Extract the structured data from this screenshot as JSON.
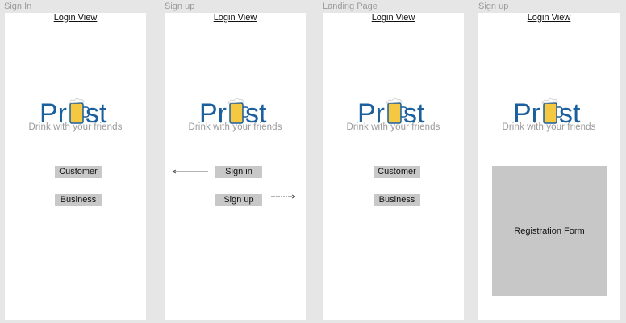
{
  "artboards": [
    {
      "title": "Sign In",
      "link": "Login View",
      "buttons": [
        "Customer",
        "Business"
      ]
    },
    {
      "title": "Sign up",
      "link": "Login View",
      "buttons": [
        "Sign in",
        "Sign up"
      ]
    },
    {
      "title": "Landing Page",
      "link": "Login View",
      "buttons": [
        "Customer",
        "Business"
      ]
    },
    {
      "title": "Sign up",
      "link": "Login View",
      "form_label": "Registration Form"
    }
  ],
  "logo": {
    "text_left": "Pr",
    "text_right": "st",
    "tagline": "Drink with your friends",
    "brand_color": "#1a5f9e",
    "beer_color": "#f5c842",
    "foam_color": "#ffffff"
  },
  "colors": {
    "canvas": "#e6e6e6",
    "artboard": "#ffffff",
    "button": "#c8c8c8",
    "form": "#c7c7c7",
    "label": "#9a9a9a"
  }
}
